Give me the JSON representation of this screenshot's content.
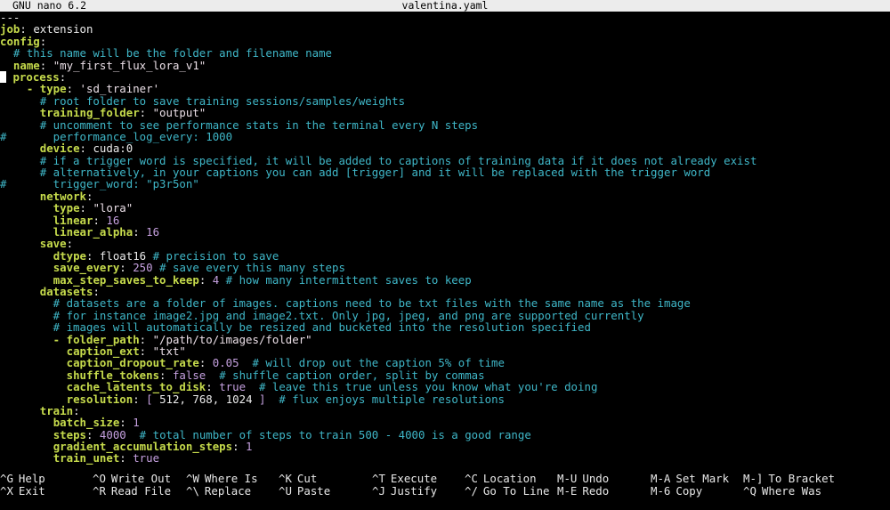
{
  "window": {
    "app_name": "GNU nano 6.2",
    "file_name": "valentina.yaml"
  },
  "editor": {
    "lines": [
      [
        {
          "t": "---",
          "c": "p"
        }
      ],
      [
        {
          "t": "job",
          "c": "k"
        },
        {
          "t": ": ",
          "c": "p"
        },
        {
          "t": "extension",
          "c": "v"
        }
      ],
      [
        {
          "t": "config",
          "c": "k"
        },
        {
          "t": ":",
          "c": "p"
        }
      ],
      [
        {
          "t": "  # this name will be the folder and filename name",
          "c": "c"
        }
      ],
      [
        {
          "t": "  ",
          "c": "p"
        },
        {
          "t": "name",
          "c": "k"
        },
        {
          "t": ": ",
          "c": "p"
        },
        {
          "t": "\"my_first_flux_lora_v1\"",
          "c": "s"
        }
      ],
      [
        {
          "t": "",
          "c": "cursor"
        },
        {
          "t": " ",
          "c": "p"
        },
        {
          "t": "process",
          "c": "k"
        },
        {
          "t": ":",
          "c": "p"
        }
      ],
      [
        {
          "t": "    - ",
          "c": "k"
        },
        {
          "t": "type",
          "c": "k"
        },
        {
          "t": ": ",
          "c": "p"
        },
        {
          "t": "'sd_trainer'",
          "c": "s"
        }
      ],
      [
        {
          "t": "      # root folder to save training sessions/samples/weights",
          "c": "c"
        }
      ],
      [
        {
          "t": "      ",
          "c": "p"
        },
        {
          "t": "training_folder",
          "c": "k"
        },
        {
          "t": ": ",
          "c": "p"
        },
        {
          "t": "\"output\"",
          "c": "s"
        }
      ],
      [
        {
          "t": "      # uncomment to see performance stats in the terminal every N steps",
          "c": "c"
        }
      ],
      [
        {
          "t": "#       performance_log_every: 1000",
          "c": "c"
        }
      ],
      [
        {
          "t": "      ",
          "c": "p"
        },
        {
          "t": "device",
          "c": "k"
        },
        {
          "t": ": ",
          "c": "p"
        },
        {
          "t": "cuda:0",
          "c": "v"
        }
      ],
      [
        {
          "t": "      # if a trigger word is specified, it will be added to captions of training data if it does not already exist",
          "c": "c"
        }
      ],
      [
        {
          "t": "      # alternatively, in your captions you can add [trigger] and it will be replaced with the trigger word",
          "c": "c"
        }
      ],
      [
        {
          "t": "#       trigger_word: \"p3r5on\"",
          "c": "c"
        }
      ],
      [
        {
          "t": "      ",
          "c": "p"
        },
        {
          "t": "network",
          "c": "k"
        },
        {
          "t": ":",
          "c": "p"
        }
      ],
      [
        {
          "t": "        ",
          "c": "p"
        },
        {
          "t": "type",
          "c": "k"
        },
        {
          "t": ": ",
          "c": "p"
        },
        {
          "t": "\"lora\"",
          "c": "s"
        }
      ],
      [
        {
          "t": "        ",
          "c": "p"
        },
        {
          "t": "linear",
          "c": "k"
        },
        {
          "t": ": ",
          "c": "p"
        },
        {
          "t": "16",
          "c": "n"
        }
      ],
      [
        {
          "t": "        ",
          "c": "p"
        },
        {
          "t": "linear_alpha",
          "c": "k"
        },
        {
          "t": ": ",
          "c": "p"
        },
        {
          "t": "16",
          "c": "n"
        }
      ],
      [
        {
          "t": "      ",
          "c": "p"
        },
        {
          "t": "save",
          "c": "k"
        },
        {
          "t": ":",
          "c": "p"
        }
      ],
      [
        {
          "t": "        ",
          "c": "p"
        },
        {
          "t": "dtype",
          "c": "k"
        },
        {
          "t": ": ",
          "c": "p"
        },
        {
          "t": "float16 ",
          "c": "v"
        },
        {
          "t": "# precision to save",
          "c": "c"
        }
      ],
      [
        {
          "t": "        ",
          "c": "p"
        },
        {
          "t": "save_every",
          "c": "k"
        },
        {
          "t": ": ",
          "c": "p"
        },
        {
          "t": "250 ",
          "c": "n"
        },
        {
          "t": "# save every this many steps",
          "c": "c"
        }
      ],
      [
        {
          "t": "        ",
          "c": "p"
        },
        {
          "t": "max_step_saves_to_keep",
          "c": "k"
        },
        {
          "t": ": ",
          "c": "p"
        },
        {
          "t": "4 ",
          "c": "n"
        },
        {
          "t": "# how many intermittent saves to keep",
          "c": "c"
        }
      ],
      [
        {
          "t": "      ",
          "c": "p"
        },
        {
          "t": "datasets",
          "c": "k"
        },
        {
          "t": ":",
          "c": "p"
        }
      ],
      [
        {
          "t": "        # datasets are a folder of images. captions need to be txt files with the same name as the image",
          "c": "c"
        }
      ],
      [
        {
          "t": "        # for instance image2.jpg and image2.txt. Only jpg, jpeg, and png are supported currently",
          "c": "c"
        }
      ],
      [
        {
          "t": "        # images will automatically be resized and bucketed into the resolution specified",
          "c": "c"
        }
      ],
      [
        {
          "t": "        - ",
          "c": "k"
        },
        {
          "t": "folder_path",
          "c": "k"
        },
        {
          "t": ": ",
          "c": "p"
        },
        {
          "t": "\"/path/to/images/folder\"",
          "c": "s"
        }
      ],
      [
        {
          "t": "          ",
          "c": "p"
        },
        {
          "t": "caption_ext",
          "c": "k"
        },
        {
          "t": ": ",
          "c": "p"
        },
        {
          "t": "\"txt\"",
          "c": "s"
        }
      ],
      [
        {
          "t": "          ",
          "c": "p"
        },
        {
          "t": "caption_dropout_rate",
          "c": "k"
        },
        {
          "t": ": ",
          "c": "p"
        },
        {
          "t": "0.05",
          "c": "n"
        },
        {
          "t": "  # will drop out the caption 5% of time",
          "c": "c"
        }
      ],
      [
        {
          "t": "          ",
          "c": "p"
        },
        {
          "t": "shuffle_tokens",
          "c": "k"
        },
        {
          "t": ": ",
          "c": "p"
        },
        {
          "t": "false",
          "c": "n"
        },
        {
          "t": "  # shuffle caption order, split by commas",
          "c": "c"
        }
      ],
      [
        {
          "t": "          ",
          "c": "p"
        },
        {
          "t": "cache_latents_to_disk",
          "c": "k"
        },
        {
          "t": ": ",
          "c": "p"
        },
        {
          "t": "true",
          "c": "n"
        },
        {
          "t": "  # leave this true unless you know what you're doing",
          "c": "c"
        }
      ],
      [
        {
          "t": "          ",
          "c": "p"
        },
        {
          "t": "resolution",
          "c": "k"
        },
        {
          "t": ": ",
          "c": "p"
        },
        {
          "t": "[ ",
          "c": "n"
        },
        {
          "t": "512",
          "c": "v"
        },
        {
          "t": ", ",
          "c": "p"
        },
        {
          "t": "768",
          "c": "v"
        },
        {
          "t": ", ",
          "c": "p"
        },
        {
          "t": "1024",
          "c": "v"
        },
        {
          "t": " ]",
          "c": "n"
        },
        {
          "t": "  # flux enjoys multiple resolutions",
          "c": "c"
        }
      ],
      [
        {
          "t": "      ",
          "c": "p"
        },
        {
          "t": "train",
          "c": "k"
        },
        {
          "t": ":",
          "c": "p"
        }
      ],
      [
        {
          "t": "        ",
          "c": "p"
        },
        {
          "t": "batch_size",
          "c": "k"
        },
        {
          "t": ": ",
          "c": "p"
        },
        {
          "t": "1",
          "c": "n"
        }
      ],
      [
        {
          "t": "        ",
          "c": "p"
        },
        {
          "t": "steps",
          "c": "k"
        },
        {
          "t": ": ",
          "c": "p"
        },
        {
          "t": "4000",
          "c": "n"
        },
        {
          "t": "  # total number of steps to train 500 - 4000 is a good range",
          "c": "c"
        }
      ],
      [
        {
          "t": "        ",
          "c": "p"
        },
        {
          "t": "gradient_accumulation_steps",
          "c": "k"
        },
        {
          "t": ": ",
          "c": "p"
        },
        {
          "t": "1",
          "c": "n"
        }
      ],
      [
        {
          "t": "        ",
          "c": "p"
        },
        {
          "t": "train_unet",
          "c": "k"
        },
        {
          "t": ": ",
          "c": "p"
        },
        {
          "t": "true",
          "c": "n"
        }
      ]
    ]
  },
  "shortcuts": [
    {
      "key": "^G",
      "label": "Help"
    },
    {
      "key": "^X",
      "label": "Exit"
    },
    {
      "key": "^O",
      "label": "Write Out"
    },
    {
      "key": "^R",
      "label": "Read File"
    },
    {
      "key": "^W",
      "label": "Where Is"
    },
    {
      "key": "^\\",
      "label": "Replace"
    },
    {
      "key": "^K",
      "label": "Cut"
    },
    {
      "key": "^U",
      "label": "Paste"
    },
    {
      "key": "^T",
      "label": "Execute"
    },
    {
      "key": "^J",
      "label": "Justify"
    },
    {
      "key": "^C",
      "label": "Location"
    },
    {
      "key": "^/",
      "label": "Go To Line"
    },
    {
      "key": "M-U",
      "label": "Undo"
    },
    {
      "key": "M-E",
      "label": "Redo"
    },
    {
      "key": "M-A",
      "label": "Set Mark"
    },
    {
      "key": "M-6",
      "label": "Copy"
    },
    {
      "key": "M-]",
      "label": "To Bracket"
    },
    {
      "key": "^Q",
      "label": "Where Was"
    }
  ],
  "colors": {
    "key": "#c6db4c",
    "comment": "#3fb7c8",
    "string": "#ece0e8",
    "number": "#c5a0df",
    "background": "#000000"
  }
}
